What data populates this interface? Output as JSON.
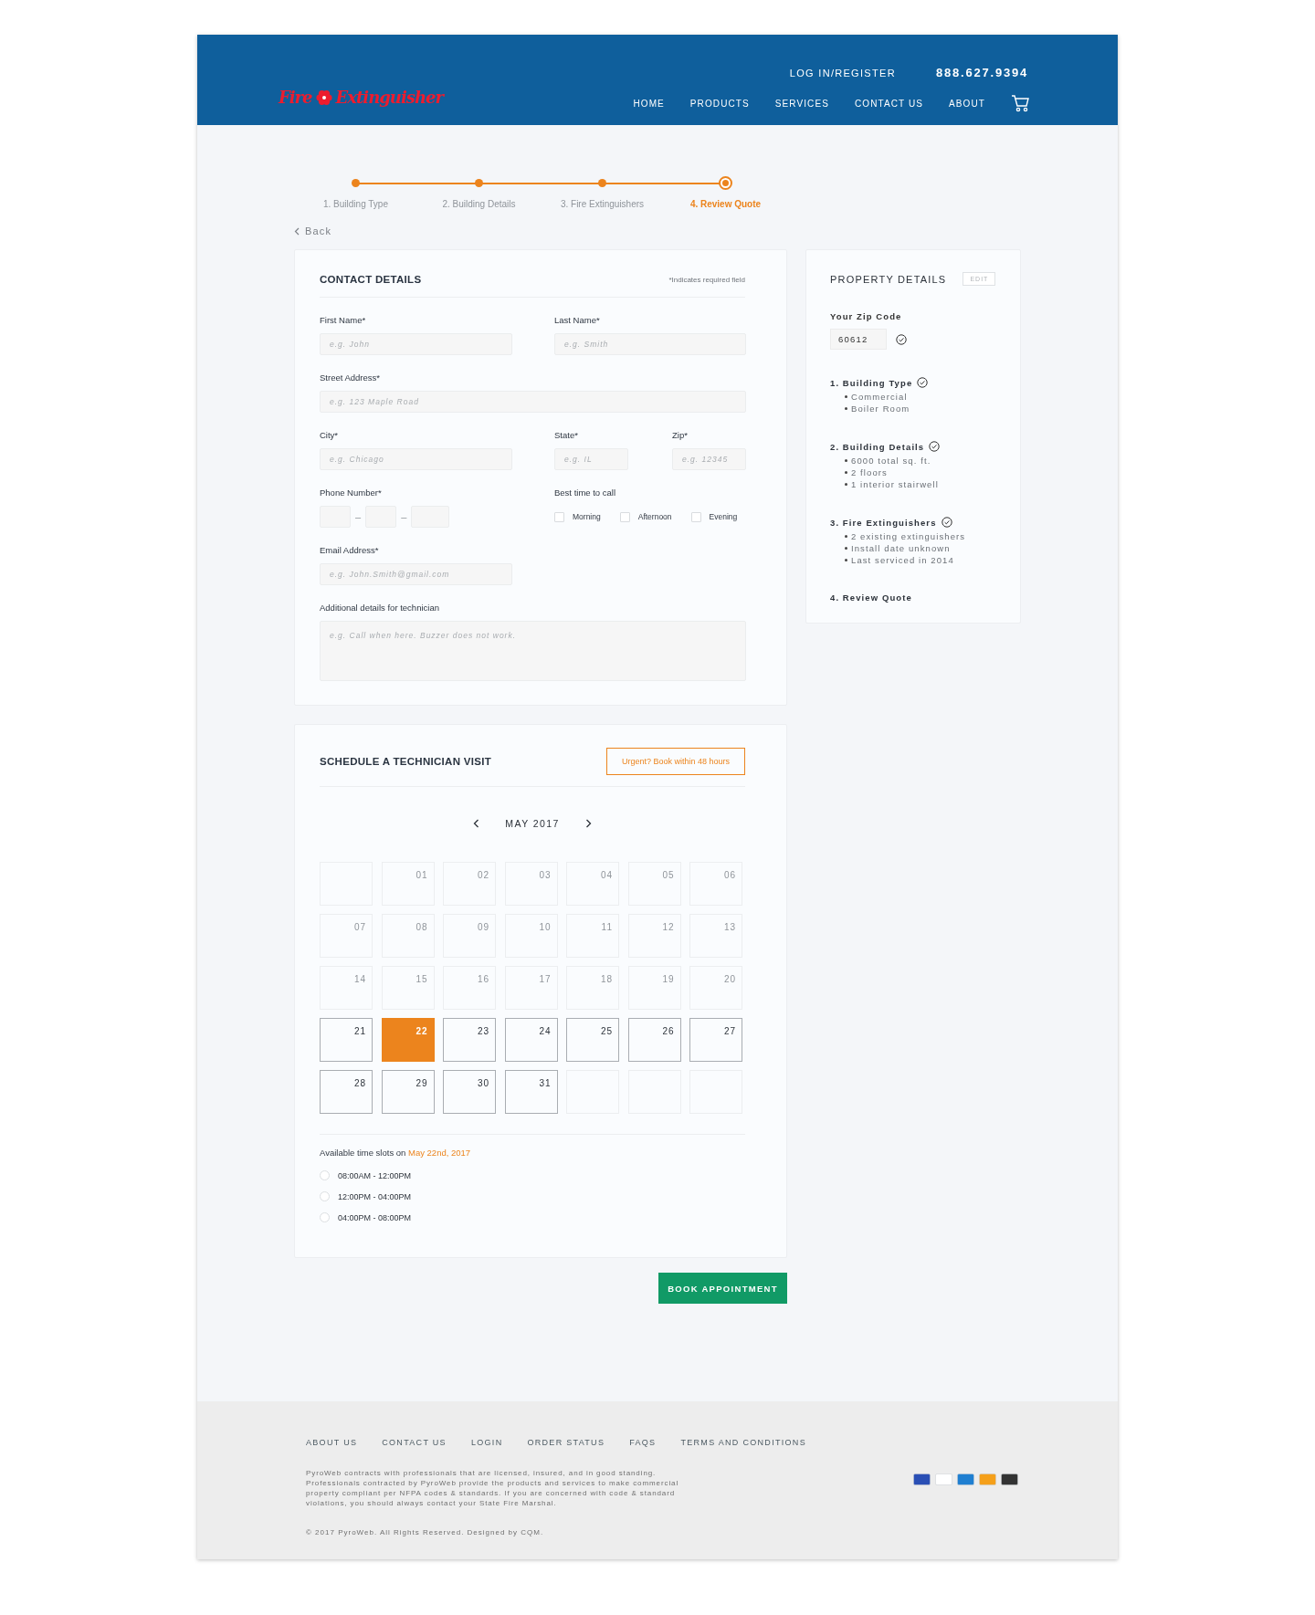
{
  "header": {
    "logo": {
      "first": "Fire",
      "second": "Extinguisher"
    },
    "login": "LOG IN/REGISTER",
    "phone": "888.627.9394",
    "nav": [
      "HOME",
      "PRODUCTS",
      "SERVICES",
      "CONTACT US",
      "ABOUT"
    ]
  },
  "stepper": {
    "steps": [
      {
        "label": "1. Building Type",
        "selected": false
      },
      {
        "label": "2. Building Details",
        "selected": false
      },
      {
        "label": "3. Fire Extinguishers",
        "selected": false
      },
      {
        "label": "4. Review Quote",
        "selected": true
      }
    ]
  },
  "back": "Back",
  "contact": {
    "title": "CONTACT DETAILS",
    "note": "*Indicates required field",
    "first_name": {
      "label": "First Name*",
      "placeholder": "e.g. John"
    },
    "last_name": {
      "label": "Last Name*",
      "placeholder": "e.g. Smith"
    },
    "street": {
      "label": "Street Address*",
      "placeholder": "e.g. 123 Maple Road"
    },
    "city": {
      "label": "City*",
      "placeholder": "e.g. Chicago"
    },
    "state": {
      "label": "State*",
      "placeholder": "e.g. IL"
    },
    "zip": {
      "label": "Zip*",
      "placeholder": "e.g. 12345"
    },
    "phone": {
      "label": "Phone Number*",
      "separators": [
        "–",
        "–"
      ]
    },
    "best_time": {
      "label": "Best time to call",
      "options": [
        {
          "label": "Morning",
          "checked": false
        },
        {
          "label": "Afternoon",
          "checked": false
        },
        {
          "label": "Evening",
          "checked": false
        }
      ]
    },
    "email": {
      "label": "Email Address*",
      "placeholder": "e.g. John.Smith@gmail.com"
    },
    "details": {
      "label": "Additional details for technician",
      "placeholder": "e.g. Call when here. Buzzer does not work."
    }
  },
  "property": {
    "title": "PROPERTY DETAILS",
    "edit": "EDIT",
    "zip_label": "Your Zip Code",
    "zip_value": "60612",
    "zip_valid": true,
    "sections": [
      {
        "title": "1. Building Type",
        "done": true,
        "items": [
          "Commercial",
          "Boiler Room"
        ]
      },
      {
        "title": "2. Building Details",
        "done": true,
        "items": [
          "6000 total sq. ft.",
          "2 floors",
          "1 interior stairwell"
        ]
      },
      {
        "title": "3. Fire Extinguishers",
        "done": true,
        "items": [
          "2 existing extinguishers",
          "Install date unknown",
          "Last serviced in 2014"
        ]
      },
      {
        "title": "4. Review Quote",
        "done": false
      }
    ]
  },
  "schedule": {
    "title": "SCHEDULE A TECHNICIAN VISIT",
    "urgent": "Urgent? Book within 48 hours",
    "month": "MAY 2017",
    "days": [
      {
        "kind": "blank",
        "selected": false
      },
      {
        "kind": "past",
        "label": "01",
        "selected": false
      },
      {
        "kind": "past",
        "label": "02",
        "selected": false
      },
      {
        "kind": "past",
        "label": "03",
        "selected": false
      },
      {
        "kind": "past",
        "label": "04",
        "selected": false
      },
      {
        "kind": "past",
        "label": "05",
        "selected": false
      },
      {
        "kind": "past",
        "label": "06",
        "selected": false
      },
      {
        "kind": "past",
        "label": "07",
        "selected": false
      },
      {
        "kind": "past",
        "label": "08",
        "selected": false
      },
      {
        "kind": "past",
        "label": "09",
        "selected": false
      },
      {
        "kind": "past",
        "label": "10",
        "selected": false
      },
      {
        "kind": "past",
        "label": "11",
        "selected": false
      },
      {
        "kind": "past",
        "label": "12",
        "selected": false
      },
      {
        "kind": "past",
        "label": "13",
        "selected": false
      },
      {
        "kind": "past",
        "label": "14",
        "selected": false
      },
      {
        "kind": "past",
        "label": "15",
        "selected": false
      },
      {
        "kind": "past",
        "label": "16",
        "selected": false
      },
      {
        "kind": "past",
        "label": "17",
        "selected": false
      },
      {
        "kind": "past",
        "label": "18",
        "selected": false
      },
      {
        "kind": "past",
        "label": "19",
        "selected": false
      },
      {
        "kind": "past",
        "label": "20",
        "selected": false
      },
      {
        "kind": "available",
        "label": "21",
        "selected": false
      },
      {
        "kind": "available",
        "label": "22",
        "selected": true
      },
      {
        "kind": "available",
        "label": "23",
        "selected": false
      },
      {
        "kind": "available",
        "label": "24",
        "selected": false
      },
      {
        "kind": "available",
        "label": "25",
        "selected": false
      },
      {
        "kind": "available",
        "label": "26",
        "selected": false
      },
      {
        "kind": "available",
        "label": "27",
        "selected": false
      },
      {
        "kind": "available",
        "label": "28",
        "selected": false
      },
      {
        "kind": "available",
        "label": "29",
        "selected": false
      },
      {
        "kind": "available",
        "label": "30",
        "selected": false
      },
      {
        "kind": "available",
        "label": "31",
        "selected": false
      },
      {
        "kind": "blank",
        "selected": false
      },
      {
        "kind": "blank",
        "selected": false
      },
      {
        "kind": "blank",
        "selected": false
      }
    ],
    "slots_prefix": "Available time slots on",
    "slots_date": "May 22nd, 2017",
    "slots": [
      {
        "label": "08:00AM - 12:00PM",
        "selected": false
      },
      {
        "label": "12:00PM - 04:00PM",
        "selected": false
      },
      {
        "label": "04:00PM - 08:00PM",
        "selected": false
      }
    ]
  },
  "book": "BOOK APPOINTMENT",
  "footer": {
    "links": [
      "ABOUT US",
      "CONTACT US",
      "LOGIN",
      "ORDER STATUS",
      "FAQS",
      "TERMS AND CONDITIONS"
    ],
    "disclaimer": "PyroWeb contracts with professionals that are licensed, insured, and in good standing. Professionals contracted by PyroWeb provide the products and services to make commercial property compliant per NFPA codes & standards. If you are concerned with code & standard violations, you should always contact your State Fire Marshal.",
    "copyright": "© 2017 PyroWeb. All Rights Reserved. Designed by CQM.",
    "payment_cards": [
      {
        "color": "#2a4fb5"
      },
      {
        "color": "#ffffff"
      },
      {
        "color": "#1f7fd1"
      },
      {
        "color": "#f5a01a"
      },
      {
        "color": "#333333"
      }
    ]
  }
}
